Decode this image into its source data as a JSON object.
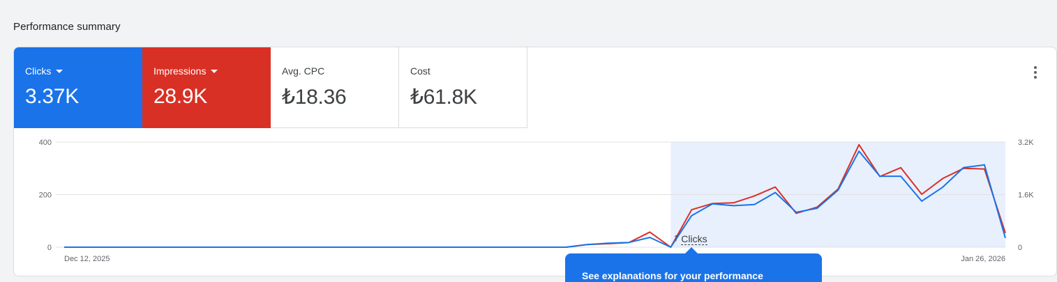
{
  "colors": {
    "clicks": "#1a73e8",
    "impressions": "#d93025",
    "highlight": "#e8f0fe",
    "grid": "#e0e0e0"
  },
  "section": {
    "title": "Performance summary"
  },
  "metrics": [
    {
      "label": "Clicks",
      "value": "3.37K"
    },
    {
      "label": "Impressions",
      "value": "28.9K"
    },
    {
      "label": "Avg. CPC",
      "value": "₺18.36"
    },
    {
      "label": "Cost",
      "value": "₺61.8K"
    }
  ],
  "annotation": {
    "label": "Clicks",
    "icon": "arrow-up-icon"
  },
  "tooltip": {
    "text": "See explanations for your performance"
  },
  "chart_data": {
    "type": "line",
    "x_start_label": "Dec 12, 2025",
    "x_end_label": "Jan 26, 2026",
    "left_axis": {
      "ticks": [
        0,
        200,
        400
      ],
      "labels": [
        "0",
        "200",
        "400"
      ],
      "range": [
        0,
        400
      ]
    },
    "right_axis": {
      "ticks": [
        0,
        1600,
        3200
      ],
      "labels": [
        "0",
        "1.6K",
        "3.2K"
      ],
      "range": [
        0,
        3200
      ]
    },
    "highlight_range": [
      29,
      45
    ],
    "series": [
      {
        "name": "Clicks",
        "axis": "left",
        "values": [
          0,
          0,
          0,
          0,
          0,
          0,
          0,
          0,
          0,
          0,
          0,
          0,
          0,
          0,
          0,
          0,
          0,
          0,
          0,
          0,
          0,
          0,
          0,
          0,
          0,
          10,
          15,
          18,
          37,
          0,
          120,
          165,
          158,
          162,
          208,
          133,
          148,
          217,
          365,
          270,
          270,
          175,
          228,
          303,
          313,
          35
        ]
      },
      {
        "name": "Impressions",
        "axis": "right",
        "values": [
          0,
          0,
          0,
          0,
          0,
          0,
          0,
          0,
          0,
          0,
          0,
          0,
          0,
          0,
          0,
          0,
          0,
          0,
          0,
          0,
          0,
          0,
          0,
          0,
          0,
          80,
          105,
          140,
          460,
          0,
          1140,
          1330,
          1350,
          1560,
          1830,
          1030,
          1220,
          1770,
          3120,
          2150,
          2420,
          1610,
          2090,
          2400,
          2380,
          430
        ]
      }
    ]
  }
}
